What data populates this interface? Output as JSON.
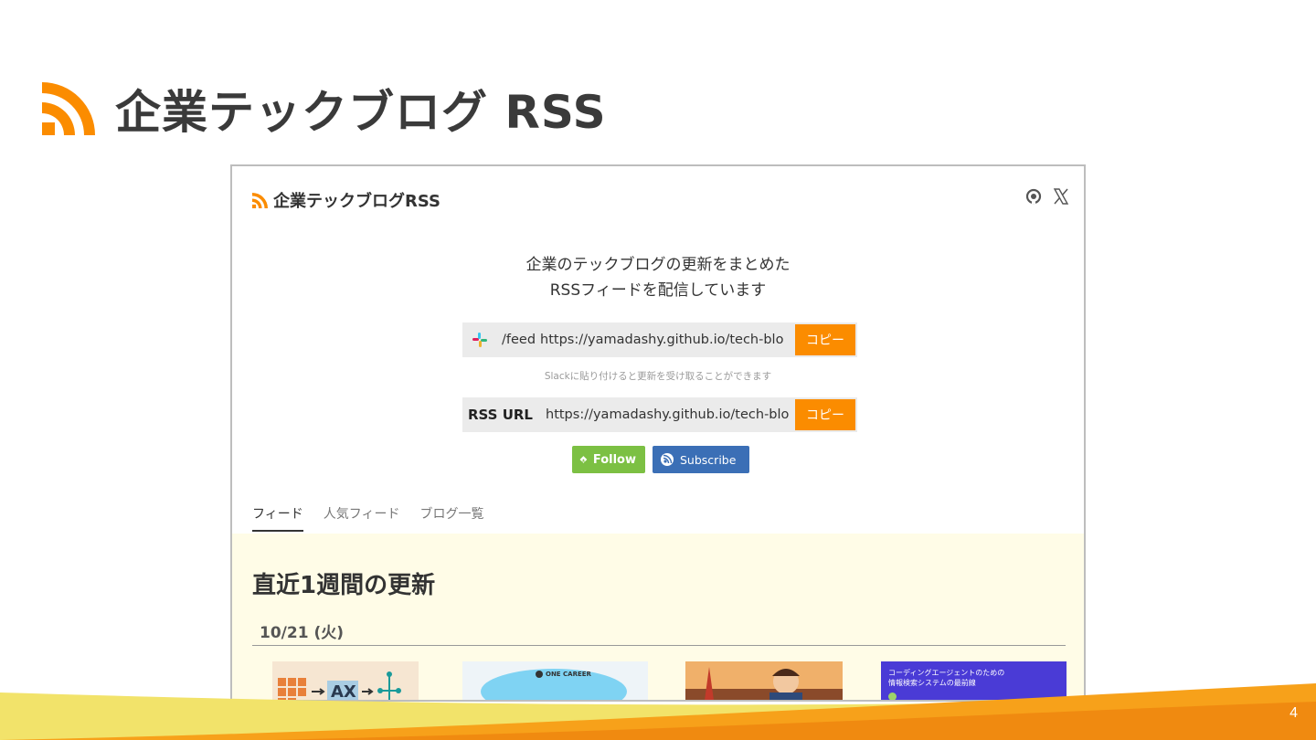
{
  "slide": {
    "title": "企業テックブログ RSS",
    "page_number": "4"
  },
  "site": {
    "title": "企業テックブログRSS",
    "description_line1": "企業のテックブログの更新をまとめた",
    "description_line2": "RSSフィードを配信しています",
    "slack": {
      "prefix": "/feed",
      "url": "https://yamadashy.github.io/tech-blo",
      "copy_label": "コピー",
      "hint": "Slackに貼り付けると更新を受け取ることができます"
    },
    "rss": {
      "label": "RSS URL",
      "url": "https://yamadashy.github.io/tech-blo",
      "copy_label": "コピー"
    },
    "badges": {
      "follow": "Follow",
      "subscribe": "Subscribe"
    },
    "tabs": [
      "フィード",
      "人気フィード",
      "ブログ一覧"
    ],
    "section_title": "直近1週間の更新",
    "date_heading": "10/21 (火)",
    "thumb_texts": {
      "t1": "AX",
      "t2_brand": "ONE CAREER",
      "t4_line1": "コーディングエージェントのための",
      "t4_line2": "情報検索システムの最前線"
    }
  },
  "colors": {
    "accent_orange": "#fb8c00",
    "follow_green": "#7cc043",
    "subscribe_blue": "#3b6fb6",
    "content_bg": "#fffce7"
  }
}
